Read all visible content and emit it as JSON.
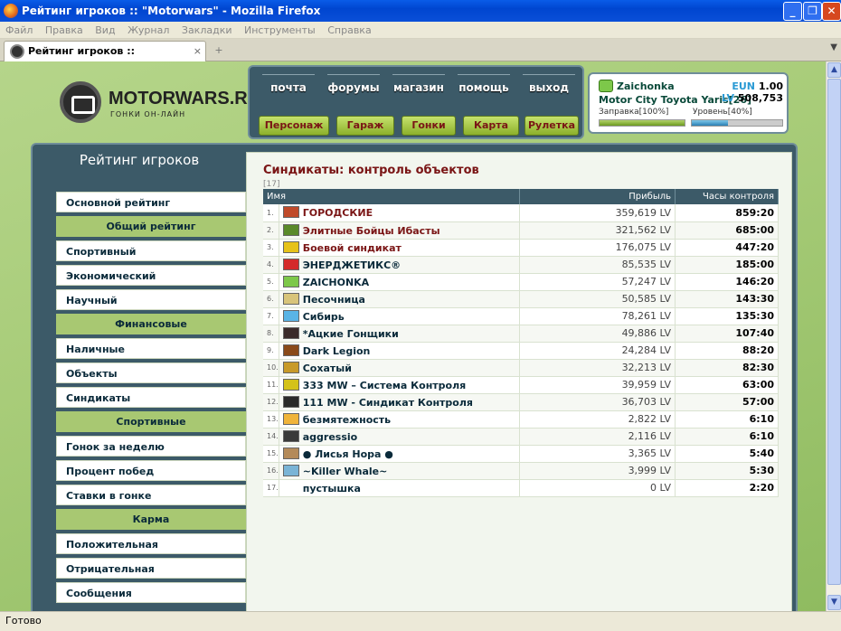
{
  "window": {
    "title": "Рейтинг игроков :: \"Motorwars\" - Mozilla Firefox"
  },
  "menu": [
    "Файл",
    "Правка",
    "Вид",
    "Журнал",
    "Закладки",
    "Инструменты",
    "Справка"
  ],
  "tab": {
    "title": "Рейтинг игроков :: \"Motorwars\""
  },
  "status": "Готово",
  "logo": {
    "text": "MOTORWARS.RU",
    "subtitle": "ГОНКИ ОН-ЛАЙН"
  },
  "nav_top": [
    "почта",
    "форумы",
    "магазин",
    "помощь",
    "выход"
  ],
  "nav_buttons": [
    "Персонаж",
    "Гараж",
    "Гонки",
    "Карта",
    "Рулетка"
  ],
  "user": {
    "name": "Zaichonka",
    "car": "Motor City Toyota Yaris[26]",
    "eun_label": "EUN",
    "eun_value": "1.00",
    "lv_label": "LV",
    "lv_value": "508,753",
    "fuel_label": "Заправка[100%]",
    "level_label": "Уровень[40%]",
    "fuel_pct": 100,
    "level_pct": 40
  },
  "sidebar": {
    "title": "Рейтинг игроков",
    "items": [
      {
        "type": "item",
        "label": "Основной рейтинг"
      },
      {
        "type": "head",
        "label": "Общий рейтинг"
      },
      {
        "type": "item",
        "label": "Спортивный"
      },
      {
        "type": "item",
        "label": "Экономический"
      },
      {
        "type": "item",
        "label": "Научный"
      },
      {
        "type": "head",
        "label": "Финансовые"
      },
      {
        "type": "item",
        "label": "Наличные"
      },
      {
        "type": "item",
        "label": "Объекты"
      },
      {
        "type": "item",
        "label": "Синдикаты"
      },
      {
        "type": "head",
        "label": "Спортивные"
      },
      {
        "type": "item",
        "label": "Гонок за неделю"
      },
      {
        "type": "item",
        "label": "Процент побед"
      },
      {
        "type": "item",
        "label": "Ставки в гонке"
      },
      {
        "type": "head",
        "label": "Карма"
      },
      {
        "type": "item",
        "label": "Положительная"
      },
      {
        "type": "item",
        "label": "Отрицательная"
      },
      {
        "type": "item",
        "label": "Сообщения"
      }
    ]
  },
  "content": {
    "title": "Синдикаты: контроль объектов",
    "count": "[17]",
    "columns": [
      "Имя",
      "Прибыль",
      "Часы контроля"
    ],
    "rows": [
      {
        "n": "1.",
        "name": "ГОРОДСКИЕ",
        "profit": "359,619 LV",
        "hours": "859:20",
        "color": "#c04a2a",
        "red": true
      },
      {
        "n": "2.",
        "name": "Элитные Бойцы Ибасты",
        "profit": "321,562 LV",
        "hours": "685:00",
        "color": "#5a8a2a",
        "red": true
      },
      {
        "n": "3.",
        "name": "Боевой синдикат",
        "profit": "176,075 LV",
        "hours": "447:20",
        "color": "#e6c21a",
        "red": true
      },
      {
        "n": "4.",
        "name": "ЭНЕРДЖЕТИКС®",
        "profit": "85,535 LV",
        "hours": "185:00",
        "color": "#d42a2a",
        "red": false
      },
      {
        "n": "5.",
        "name": "ZAICHONKA",
        "profit": "57,247 LV",
        "hours": "146:20",
        "color": "#7dc84a",
        "red": false
      },
      {
        "n": "6.",
        "name": "Песочница",
        "profit": "50,585 LV",
        "hours": "143:30",
        "color": "#d8c47a",
        "red": false
      },
      {
        "n": "7.",
        "name": "Сибирь",
        "profit": "78,261 LV",
        "hours": "135:30",
        "color": "#5ab4e6",
        "red": false
      },
      {
        "n": "8.",
        "name": "*Ацкие Гонщики",
        "profit": "49,886 LV",
        "hours": "107:40",
        "color": "#3a2a2a",
        "red": false
      },
      {
        "n": "9.",
        "name": "Dark Legion",
        "profit": "24,284 LV",
        "hours": "88:20",
        "color": "#8a4a1a",
        "red": false
      },
      {
        "n": "10.",
        "name": "Сохатый",
        "profit": "32,213 LV",
        "hours": "82:30",
        "color": "#c89a2a",
        "red": false
      },
      {
        "n": "11.",
        "name": "333 MW – Система Контроля",
        "profit": "39,959 LV",
        "hours": "63:00",
        "color": "#d4c21a",
        "red": false
      },
      {
        "n": "12.",
        "name": "111 MW - Синдикат Контроля",
        "profit": "36,703 LV",
        "hours": "57:00",
        "color": "#2a2a2a",
        "red": false
      },
      {
        "n": "13.",
        "name": "безмятежность",
        "profit": "2,822 LV",
        "hours": "6:10",
        "color": "#f0b43a",
        "red": false
      },
      {
        "n": "14.",
        "name": "aggressio",
        "profit": "2,116 LV",
        "hours": "6:10",
        "color": "#3a3a3a",
        "red": false
      },
      {
        "n": "15.",
        "name": "● Лисья Нора ●",
        "profit": "3,365 LV",
        "hours": "5:40",
        "color": "#b48a5a",
        "red": false
      },
      {
        "n": "16.",
        "name": "~Killer Whale~",
        "profit": "3,999 LV",
        "hours": "5:30",
        "color": "#7ab4d6",
        "red": false
      },
      {
        "n": "17.",
        "name": "пустышка",
        "profit": "0 LV",
        "hours": "2:20",
        "color": "",
        "red": false
      }
    ]
  }
}
